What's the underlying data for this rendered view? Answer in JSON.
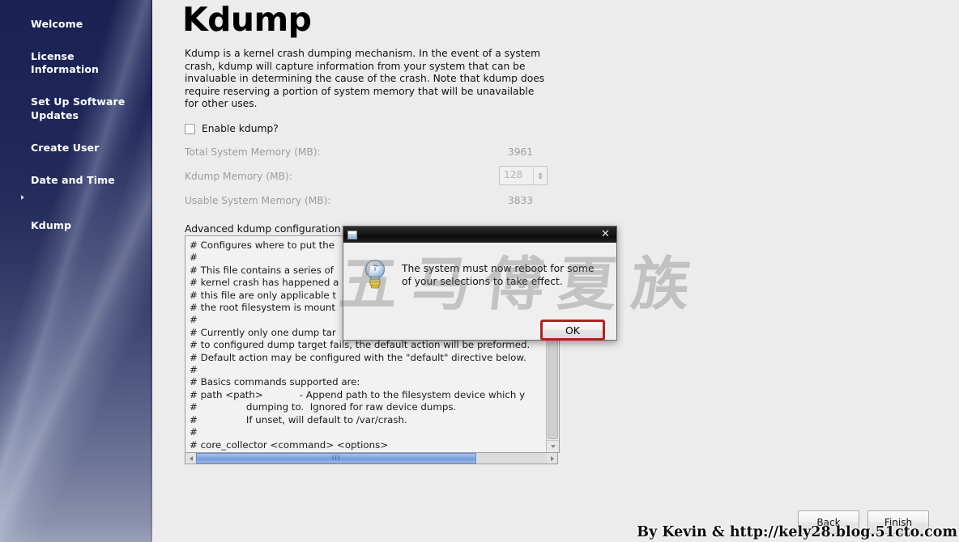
{
  "sidebar": {
    "items": [
      {
        "label": "Welcome",
        "selected": false
      },
      {
        "label": "License\nInformation",
        "selected": false
      },
      {
        "label": "Set Up Software\nUpdates",
        "selected": false
      },
      {
        "label": "Create User",
        "selected": false
      },
      {
        "label": "Date and Time",
        "selected": false
      },
      {
        "label": "Kdump",
        "selected": true
      }
    ]
  },
  "page": {
    "title": "Kdump",
    "intro": "Kdump is a kernel crash dumping mechanism. In the event of a system crash, kdump will capture information from your system that can be invaluable in determining the cause of the crash. Note that kdump does require reserving a portion of system memory that will be unavailable for other uses.",
    "enable_label": "Enable kdump?",
    "enable_checked": false,
    "memory_rows": [
      {
        "label": "Total System Memory (MB):",
        "value": "3961"
      },
      {
        "label": "Kdump Memory (MB):",
        "value": "128"
      },
      {
        "label": "Usable System Memory (MB):",
        "value": "3833"
      }
    ],
    "advanced_label": "Advanced kdump configuration",
    "config_text": "# Configures where to put the\n#\n# This file contains a series of\n# kernel crash has happened a\n# this file are only applicable t\n# the root filesystem is mount\n#\n# Currently only one dump tar\n# to configured dump target fails, the default action will be preformed.\n# Default action may be configured with the \"default\" directive below.\n#\n# Basics commands supported are:\n# path <path>            - Append path to the filesystem device which y\n#                dumping to.  Ignored for raw device dumps.\n#                If unset, will default to /var/crash.\n#\n# core_collector <command> <options>"
  },
  "footer_buttons": {
    "back": "Back",
    "finish": "Finish"
  },
  "dialog": {
    "message": "The system must now reboot for some of your selections to take effect.",
    "ok_label": "OK",
    "close_glyph": "✕",
    "focus_color": "#b3211f"
  },
  "watermark": {
    "calligraphy": "五马傅夏族",
    "footer_text": "By Kevin & http://kely28.blog.51cto.com"
  }
}
